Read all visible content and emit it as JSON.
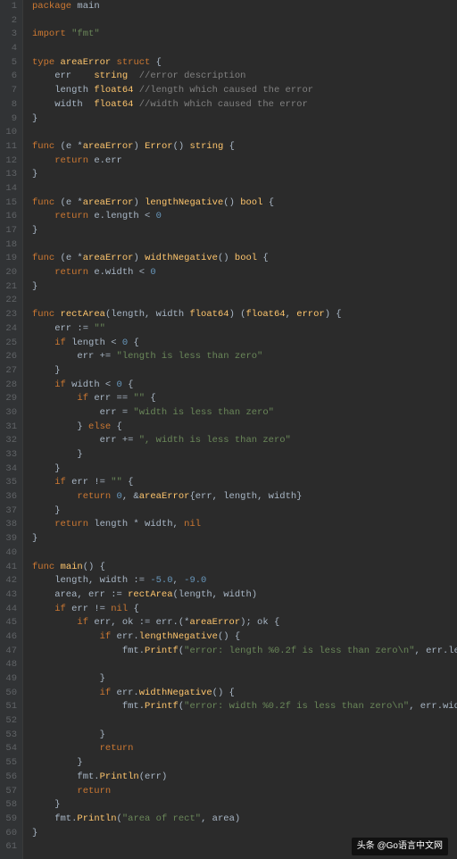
{
  "lines": [
    "1",
    "2",
    "3",
    "4",
    "5",
    "6",
    "7",
    "8",
    "9",
    "10",
    "11",
    "12",
    "13",
    "14",
    "15",
    "16",
    "17",
    "18",
    "19",
    "20",
    "21",
    "22",
    "23",
    "24",
    "25",
    "26",
    "27",
    "28",
    "29",
    "30",
    "31",
    "32",
    "33",
    "34",
    "35",
    "36",
    "37",
    "38",
    "39",
    "40",
    "41",
    "42",
    "43",
    "44",
    "45",
    "46",
    "47",
    "48",
    "49",
    "50",
    "51",
    "52",
    "53",
    "54",
    "55",
    "56",
    "57",
    "58",
    "59",
    "60",
    "61"
  ],
  "watermark": "头条 @Go语言中文网",
  "code": {
    "l1": {
      "kw1": "package",
      "id1": " main"
    },
    "l3": {
      "kw1": "import",
      "str1": " \"fmt\""
    },
    "l5": {
      "kw1": "type",
      "ty1": " areaError",
      "kw2": " struct",
      "op1": " {"
    },
    "l6": {
      "id1": "    err    ",
      "ty1": "string",
      "com1": "  //error description"
    },
    "l7": {
      "id1": "    length ",
      "ty1": "float64",
      "com1": " //length which caused the error"
    },
    "l8": {
      "id1": "    width  ",
      "ty1": "float64",
      "com1": " //width which caused the error"
    },
    "l9": {
      "op1": "}"
    },
    "l11": {
      "kw1": "func",
      "op1": " (e *",
      "ty1": "areaError",
      "op2": ") ",
      "fn1": "Error",
      "op3": "() ",
      "ty2": "string",
      "op4": " {"
    },
    "l12": {
      "kw1": "    return",
      "id1": " e.err"
    },
    "l13": {
      "op1": "}"
    },
    "l15": {
      "kw1": "func",
      "op1": " (e *",
      "ty1": "areaError",
      "op2": ") ",
      "fn1": "lengthNegative",
      "op3": "() ",
      "ty2": "bool",
      "op4": " {"
    },
    "l16": {
      "kw1": "    return",
      "id1": " e.length < ",
      "num1": "0"
    },
    "l17": {
      "op1": "}"
    },
    "l19": {
      "kw1": "func",
      "op1": " (e *",
      "ty1": "areaError",
      "op2": ") ",
      "fn1": "widthNegative",
      "op3": "() ",
      "ty2": "bool",
      "op4": " {"
    },
    "l20": {
      "kw1": "    return",
      "id1": " e.width < ",
      "num1": "0"
    },
    "l21": {
      "op1": "}"
    },
    "l23": {
      "kw1": "func",
      "fn1": " rectArea",
      "op1": "(length, width ",
      "ty1": "float64",
      "op2": ") (",
      "ty2": "float64",
      "op3": ", ",
      "ty3": "error",
      "op4": ") {"
    },
    "l24": {
      "id1": "    err := ",
      "str1": "\"\""
    },
    "l25": {
      "kw1": "    if",
      "id1": " length < ",
      "num1": "0",
      "op1": " {"
    },
    "l26": {
      "id1": "        err += ",
      "str1": "\"length is less than zero\""
    },
    "l27": {
      "op1": "    }"
    },
    "l28": {
      "kw1": "    if",
      "id1": " width < ",
      "num1": "0",
      "op1": " {"
    },
    "l29": {
      "kw1": "        if",
      "id1": " err == ",
      "str1": "\"\"",
      "op1": " {"
    },
    "l30": {
      "id1": "            err = ",
      "str1": "\"width is less than zero\""
    },
    "l31": {
      "op1": "        } ",
      "kw1": "else",
      "op2": " {"
    },
    "l32": {
      "id1": "            err += ",
      "str1": "\", width is less than zero\""
    },
    "l33": {
      "op1": "        }"
    },
    "l34": {
      "op1": "    }"
    },
    "l35": {
      "kw1": "    if",
      "id1": " err != ",
      "str1": "\"\"",
      "op1": " {"
    },
    "l36": {
      "kw1": "        return",
      "num1": " 0",
      "id1": ", &",
      "ty1": "areaError",
      "op1": "{err, length, width}"
    },
    "l37": {
      "op1": "    }"
    },
    "l38": {
      "kw1": "    return",
      "id1": " length * width, ",
      "kw2": "nil"
    },
    "l39": {
      "op1": "}"
    },
    "l41": {
      "kw1": "func",
      "fn1": " main",
      "op1": "() {"
    },
    "l42": {
      "id1": "    length, width := ",
      "num1": "-5.0",
      "id2": ", ",
      "num2": "-9.0"
    },
    "l43": {
      "id1": "    area, err := ",
      "fn1": "rectArea",
      "op1": "(length, width)"
    },
    "l44": {
      "kw1": "    if",
      "id1": " err != ",
      "kw2": "nil",
      "op1": " {"
    },
    "l45": {
      "kw1": "        if",
      "id1": " err, ok := err.(*",
      "ty1": "areaError",
      "op1": "); ok {"
    },
    "l46": {
      "kw1": "            if",
      "id1": " err.",
      "fn1": "lengthNegative",
      "op1": "() {"
    },
    "l47": {
      "id1": "                fmt.",
      "fn1": "Printf",
      "op1": "(",
      "str1": "\"error: length %0.2f is less than zero\\n\"",
      "id2": ", err.length)"
    },
    "l49": {
      "op1": "            }"
    },
    "l50": {
      "kw1": "            if",
      "id1": " err.",
      "fn1": "widthNegative",
      "op1": "() {"
    },
    "l51": {
      "id1": "                fmt.",
      "fn1": "Printf",
      "op1": "(",
      "str1": "\"error: width %0.2f is less than zero\\n\"",
      "id2": ", err.width)"
    },
    "l53": {
      "op1": "            }"
    },
    "l54": {
      "kw1": "            return"
    },
    "l55": {
      "op1": "        }"
    },
    "l56": {
      "id1": "        fmt.",
      "fn1": "Println",
      "op1": "(err)"
    },
    "l57": {
      "kw1": "        return"
    },
    "l58": {
      "op1": "    }"
    },
    "l59": {
      "id1": "    fmt.",
      "fn1": "Println",
      "op1": "(",
      "str1": "\"area of rect\"",
      "id2": ", area)"
    },
    "l60": {
      "op1": "}"
    }
  }
}
